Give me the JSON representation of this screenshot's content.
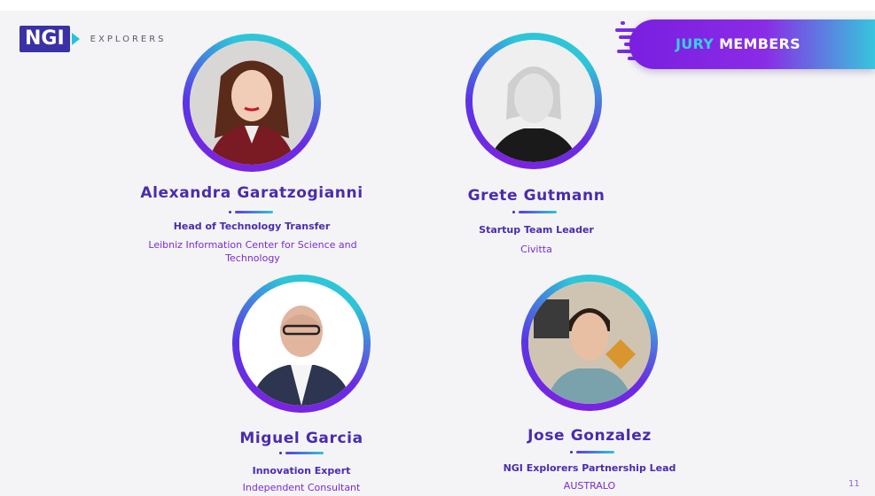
{
  "logo": {
    "mark": "NGI",
    "text": "EXPLORERS"
  },
  "banner": {
    "highlight": "JURY",
    "rest": "MEMBERS"
  },
  "page_number": "11",
  "members": [
    {
      "name": "Alexandra Garatzogianni",
      "role": "Head of Technology Transfer",
      "org": "Leibniz Information Center for Science and Technology"
    },
    {
      "name": "Grete Gutmann",
      "role": "Startup Team Leader",
      "org": "Civitta"
    },
    {
      "name": "Miguel Garcia",
      "role": "Innovation Expert",
      "org": "Independent Consultant"
    },
    {
      "name": "Jose Gonzalez",
      "role": "NGI Explorers Partnership Lead",
      "org": "AUSTRALO"
    }
  ],
  "colors": {
    "accent_purple": "#7a1fe0",
    "accent_cyan": "#35c6dd",
    "text_dark_purple": "#4a2bb0"
  }
}
